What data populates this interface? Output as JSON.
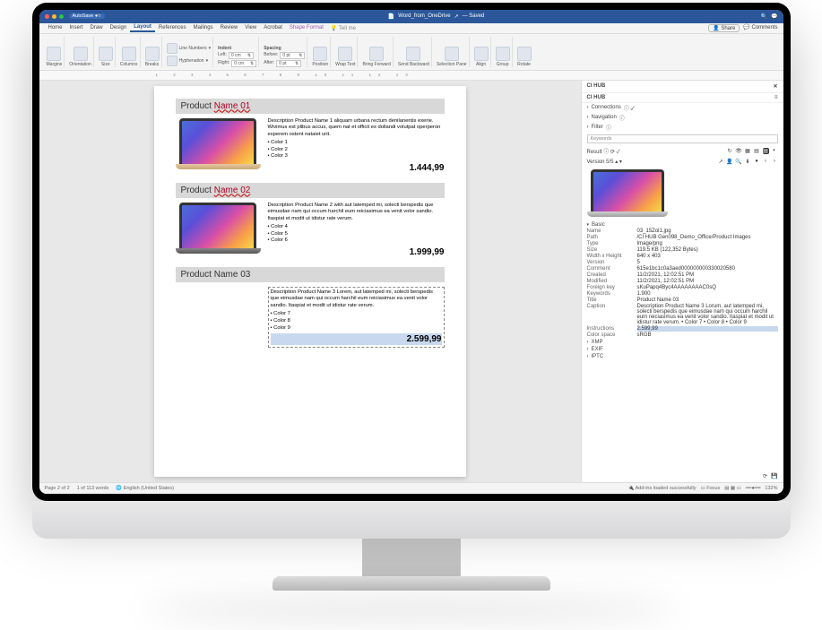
{
  "autosave": "AutoSave",
  "doc_title": "Word_from_OneDrive",
  "saved_label": "— Saved",
  "tabs": [
    "Home",
    "Insert",
    "Draw",
    "Design",
    "Layout",
    "References",
    "Mailings",
    "Review",
    "View",
    "Acrobat",
    "Shape Format"
  ],
  "tell_me": "Tell me",
  "share": "Share",
  "comments": "Comments",
  "ribbon": {
    "margins": "Margins",
    "orientation": "Orientation",
    "size": "Size",
    "columns": "Columns",
    "breaks": "Breaks",
    "line_numbers": "Line Numbers",
    "hyphenation": "Hyphenation",
    "indent": "Indent",
    "left": "Left:",
    "right": "Right:",
    "zero": "0 cm",
    "spacing": "Spacing",
    "before": "Before:",
    "after": "After:",
    "zeropt": "0 pt",
    "position": "Position",
    "wrap": "Wrap Text",
    "bring": "Bring Forward",
    "send": "Send Backward",
    "selection": "Selection Pane",
    "align": "Align",
    "group": "Group",
    "rotate": "Rotate"
  },
  "products": [
    {
      "title_a": "Product ",
      "title_b": "Name 01",
      "desc": "Description Product Name 1 aliquam urbana rectum denilanentis exerie. Wivimus est plibus accus, quem nat et officit es dollandi volutpat operperon experem ostent nataiet urit.",
      "bullets": [
        "Color 1",
        "Color 2",
        "Color 3"
      ],
      "price": "1.444,99",
      "laptop": "gold"
    },
    {
      "title_a": "Product ",
      "title_b": "Name 02",
      "desc": "Description Product Name 2 with aut latemped mi, solecti berspedis que eimusdae nam qui occum harchil eum reiciasimus ea venit volor sandio. Itaspiat et modit ut idistur rate verum.",
      "bullets": [
        "Color 4",
        "Color 5",
        "Color 6"
      ],
      "price": "1.999,99",
      "laptop": "dark"
    },
    {
      "title_a": "Product ",
      "title_b": "Name 03",
      "desc": "Description Product Name 3 Lorem, aut latemped mi, solecti berspedis que eimusdae nam qui occum harchil eum reiciasimus ea venit volor sandio. Itaspiat et modit ut idistur rate verum.",
      "bullets": [
        "Color 7",
        "Color 8",
        "Color 9"
      ],
      "price": "2.599,99",
      "laptop": ""
    }
  ],
  "panel": {
    "title": "CI HUB",
    "subtitle": "CI HUB",
    "connections": "Connections",
    "navigation": "Navigation",
    "filter": "Filter",
    "keywords_ph": "Keywords",
    "result": "Result",
    "version": "Version 5/5",
    "basic": "Basic",
    "meta": [
      {
        "k": "Name",
        "v": "03_15Zol1.jpg"
      },
      {
        "k": "Path",
        "v": "/CI HUB Gen098_Demo_Office/Product Images"
      },
      {
        "k": "Type",
        "v": "Image/png"
      },
      {
        "k": "Size",
        "v": "119.5 KB (122,352 Bytes)"
      },
      {
        "k": "Width x Height",
        "v": "640 x 403"
      },
      {
        "k": "Version",
        "v": "5"
      },
      {
        "k": "Comment",
        "v": "615e1bc1c0a3aed000000000330020580"
      },
      {
        "k": "Created",
        "v": "11/2/2021, 12:02:51 PM"
      },
      {
        "k": "Modified",
        "v": "11/2/2021, 12:02:51 PM"
      },
      {
        "k": "Foreign key",
        "v": "sKuPapq4Byc4AAAAAAAAC0sQ"
      },
      {
        "k": "Keywords",
        "v": "1.900"
      },
      {
        "k": "Title",
        "v": "Product Name 03"
      },
      {
        "k": "Caption",
        "v": "Description Product Name 3 Lorum, aut latemped mi, solecti berspedis que eimusdae nam qui occum harchil eum reiciasimus ea venit volor sandio. Itaspiat et modit ut idistur rate verum. • Color 7 • Color 8 • Color 9"
      },
      {
        "k": "Instructions",
        "v": "2.599,99",
        "sel": true
      },
      {
        "k": "Color space",
        "v": "sRGB"
      }
    ],
    "xmp": "XMP",
    "exif": "EXIF",
    "iptc": "IPTC"
  },
  "status": {
    "page": "Page 2 of 2",
    "words": "1 of 113 words",
    "lang": "English (United States)",
    "addins": "Add-ins loaded successfully",
    "focus": "Focus",
    "zoom": "132%"
  }
}
